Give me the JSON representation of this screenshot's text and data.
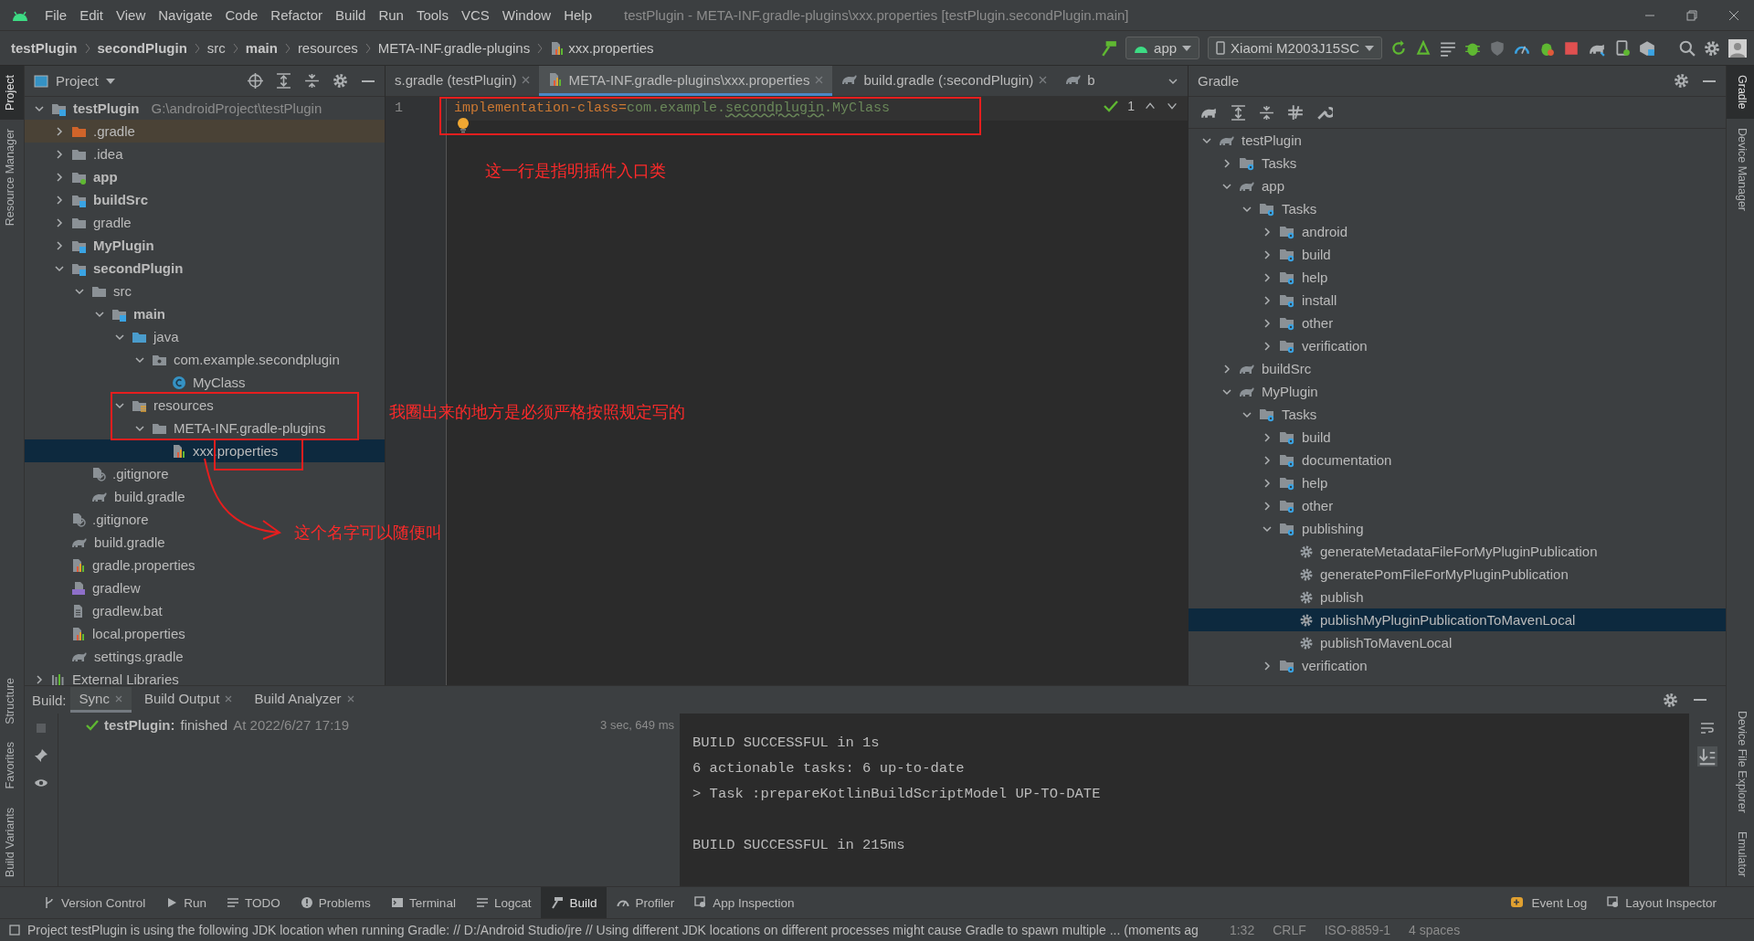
{
  "window": {
    "title": "testPlugin - META-INF.gradle-plugins\\xxx.properties [testPlugin.secondPlugin.main]"
  },
  "menu": [
    "File",
    "Edit",
    "View",
    "Navigate",
    "Code",
    "Refactor",
    "Build",
    "Run",
    "Tools",
    "VCS",
    "Window",
    "Help"
  ],
  "breadcrumbs": [
    {
      "label": "testPlugin",
      "bold": true
    },
    {
      "label": "secondPlugin",
      "bold": true
    },
    {
      "label": "src",
      "bold": false
    },
    {
      "label": "main",
      "bold": true
    },
    {
      "label": "resources",
      "bold": false
    },
    {
      "label": "META-INF.gradle-plugins",
      "bold": false
    },
    {
      "label": "xxx.properties",
      "bold": false
    }
  ],
  "toolbar": {
    "run_config": "app",
    "device": "Xiaomi M2003J15SC"
  },
  "tool_stripes": {
    "left_top": [
      {
        "label": "Project",
        "selected": true
      },
      {
        "label": "Resource Manager",
        "selected": false
      }
    ],
    "left_bottom": [
      {
        "label": "Structure",
        "selected": false
      },
      {
        "label": "Favorites",
        "selected": false
      },
      {
        "label": "Build Variants",
        "selected": false
      }
    ],
    "right_top": [
      {
        "label": "Gradle",
        "selected": true
      },
      {
        "label": "Device Manager",
        "selected": false
      }
    ],
    "right_bottom": [
      {
        "label": "Device File Explorer",
        "selected": false
      },
      {
        "label": "Emulator",
        "selected": false
      }
    ]
  },
  "project_panel": {
    "title": "Project",
    "tree": [
      {
        "label": "testPlugin",
        "detail": "G:\\androidProject\\testPlugin",
        "kind": "module",
        "bold": true,
        "expanded": true,
        "selected": false,
        "children": [
          {
            "label": ".gradle",
            "kind": "excluded-folder",
            "expanded": false,
            "selected": false
          },
          {
            "label": ".idea",
            "kind": "folder",
            "expanded": false,
            "selected": false
          },
          {
            "label": "app",
            "kind": "app-module",
            "bold": true,
            "expanded": false,
            "selected": false
          },
          {
            "label": "buildSrc",
            "kind": "module",
            "bold": true,
            "expanded": false,
            "selected": false
          },
          {
            "label": "gradle",
            "kind": "folder",
            "expanded": false,
            "selected": false
          },
          {
            "label": "MyPlugin",
            "kind": "module",
            "bold": true,
            "expanded": false,
            "selected": false
          },
          {
            "label": "secondPlugin",
            "kind": "module",
            "bold": true,
            "expanded": true,
            "selected": false,
            "children": [
              {
                "label": "src",
                "kind": "folder",
                "expanded": true,
                "selected": false,
                "children": [
                  {
                    "label": "main",
                    "kind": "module",
                    "bold": true,
                    "expanded": true,
                    "selected": false,
                    "children": [
                      {
                        "label": "java",
                        "kind": "source-folder",
                        "expanded": true,
                        "selected": false,
                        "children": [
                          {
                            "label": "com.example.secondplugin",
                            "kind": "package",
                            "expanded": true,
                            "selected": false,
                            "children": [
                              {
                                "label": "MyClass",
                                "kind": "class",
                                "selected": false
                              }
                            ]
                          }
                        ]
                      },
                      {
                        "label": "resources",
                        "kind": "resources-folder",
                        "expanded": true,
                        "selected": false,
                        "children": [
                          {
                            "label": "META-INF.gradle-plugins",
                            "kind": "folder",
                            "expanded": true,
                            "selected": false,
                            "children": [
                              {
                                "label": "xxx.properties",
                                "kind": "properties",
                                "selected": true
                              }
                            ]
                          }
                        ]
                      }
                    ]
                  }
                ]
              },
              {
                "label": ".gitignore",
                "kind": "gitignore",
                "selected": false
              },
              {
                "label": "build.gradle",
                "kind": "gradle",
                "selected": false
              }
            ]
          },
          {
            "label": ".gitignore",
            "kind": "gitignore",
            "selected": false
          },
          {
            "label": "build.gradle",
            "kind": "gradle",
            "selected": false
          },
          {
            "label": "gradle.properties",
            "kind": "properties",
            "selected": false
          },
          {
            "label": "gradlew",
            "kind": "script",
            "selected": false
          },
          {
            "label": "gradlew.bat",
            "kind": "file",
            "selected": false
          },
          {
            "label": "local.properties",
            "kind": "properties",
            "selected": false
          },
          {
            "label": "settings.gradle",
            "kind": "gradle",
            "selected": false
          }
        ]
      },
      {
        "label": "External Libraries",
        "kind": "library",
        "expanded": false,
        "selected": false
      }
    ]
  },
  "editor": {
    "tabs": [
      {
        "label": "s.gradle (testPlugin)",
        "kind": "plain",
        "selected": false,
        "closable": true
      },
      {
        "label": "META-INF.gradle-plugins\\xxx.properties",
        "kind": "properties",
        "selected": true,
        "closable": true
      },
      {
        "label": "build.gradle (:secondPlugin)",
        "kind": "gradle",
        "selected": false,
        "closable": true
      },
      {
        "label": "b",
        "kind": "gradle",
        "selected": false,
        "closable": false
      }
    ],
    "lines": [
      {
        "number": "1",
        "tokens": [
          {
            "text": "implementation-class",
            "kind": "key"
          },
          {
            "text": "=",
            "kind": "sep"
          },
          {
            "text": "com.example.",
            "kind": "value"
          },
          {
            "text": "secondplugin",
            "kind": "typo"
          },
          {
            "text": ".MyClass",
            "kind": "value"
          }
        ]
      }
    ],
    "inspection": "1"
  },
  "gradle_panel": {
    "title": "Gradle",
    "tree": [
      {
        "label": "testPlugin",
        "kind": "elephant",
        "expanded": true,
        "selected": false,
        "children": [
          {
            "label": "Tasks",
            "kind": "task-folder",
            "expanded": false,
            "selected": false
          },
          {
            "label": "app",
            "kind": "elephant",
            "expanded": true,
            "selected": false,
            "children": [
              {
                "label": "Tasks",
                "kind": "task-folder",
                "expanded": true,
                "selected": false,
                "children": [
                  {
                    "label": "android",
                    "kind": "task-folder",
                    "expanded": false,
                    "selected": false
                  },
                  {
                    "label": "build",
                    "kind": "task-folder",
                    "expanded": false,
                    "selected": false
                  },
                  {
                    "label": "help",
                    "kind": "task-folder",
                    "expanded": false,
                    "selected": false
                  },
                  {
                    "label": "install",
                    "kind": "task-folder",
                    "expanded": false,
                    "selected": false
                  },
                  {
                    "label": "other",
                    "kind": "task-folder",
                    "expanded": false,
                    "selected": false
                  },
                  {
                    "label": "verification",
                    "kind": "task-folder",
                    "expanded": false,
                    "selected": false
                  }
                ]
              }
            ]
          },
          {
            "label": "buildSrc",
            "kind": "elephant",
            "expanded": false,
            "selected": false
          },
          {
            "label": "MyPlugin",
            "kind": "elephant",
            "expanded": true,
            "selected": false,
            "children": [
              {
                "label": "Tasks",
                "kind": "task-folder",
                "expanded": true,
                "selected": false,
                "children": [
                  {
                    "label": "build",
                    "kind": "task-folder",
                    "expanded": false,
                    "selected": false
                  },
                  {
                    "label": "documentation",
                    "kind": "task-folder",
                    "expanded": false,
                    "selected": false
                  },
                  {
                    "label": "help",
                    "kind": "task-folder",
                    "expanded": false,
                    "selected": false
                  },
                  {
                    "label": "other",
                    "kind": "task-folder",
                    "expanded": false,
                    "selected": false
                  },
                  {
                    "label": "publishing",
                    "kind": "task-folder",
                    "expanded": true,
                    "selected": false,
                    "children": [
                      {
                        "label": "generateMetadataFileForMyPluginPublication",
                        "kind": "gear",
                        "selected": false
                      },
                      {
                        "label": "generatePomFileForMyPluginPublication",
                        "kind": "gear",
                        "selected": false
                      },
                      {
                        "label": "publish",
                        "kind": "gear",
                        "selected": false
                      },
                      {
                        "label": "publishMyPluginPublicationToMavenLocal",
                        "kind": "gear",
                        "selected": true
                      },
                      {
                        "label": "publishToMavenLocal",
                        "kind": "gear",
                        "selected": false
                      }
                    ]
                  },
                  {
                    "label": "verification",
                    "kind": "task-folder",
                    "expanded": false,
                    "selected": false
                  }
                ]
              }
            ]
          }
        ]
      }
    ]
  },
  "build_panel": {
    "label": "Build:",
    "tabs": [
      {
        "label": "Sync",
        "selected": true
      },
      {
        "label": "Build Output",
        "selected": false
      },
      {
        "label": "Build Analyzer",
        "selected": false
      }
    ],
    "result": {
      "project": "testPlugin:",
      "status": "finished",
      "time": "At 2022/6/27 17:19",
      "duration": "3 sec, 649 ms"
    },
    "console": [
      [
        "BUILD SUCCESSFUL in 1s",
        "6 actionable tasks: 6 up-to-date",
        "> Task :prepareKotlinBuildScriptModel UP-TO-DATE"
      ],
      [
        "BUILD SUCCESSFUL in 215ms"
      ]
    ]
  },
  "bottom_tools": {
    "left": [
      {
        "label": "Version Control",
        "kind": "branch",
        "selected": false
      },
      {
        "label": "Run",
        "kind": "play",
        "selected": false
      },
      {
        "label": "TODO",
        "kind": "list",
        "selected": false
      },
      {
        "label": "Problems",
        "kind": "info",
        "selected": false
      },
      {
        "label": "Terminal",
        "kind": "terminal",
        "selected": false
      },
      {
        "label": "Logcat",
        "kind": "list",
        "selected": false
      },
      {
        "label": "Build",
        "kind": "hammer",
        "selected": true
      },
      {
        "label": "Profiler",
        "kind": "gauge",
        "selected": false
      },
      {
        "label": "App Inspection",
        "kind": "inspect",
        "selected": false
      }
    ],
    "right": [
      {
        "label": "Event Log",
        "kind": "event",
        "selected": false
      },
      {
        "label": "Layout Inspector",
        "kind": "inspect",
        "selected": false
      }
    ]
  },
  "status_bar": {
    "message": "Project testPlugin is using the following JDK location when running Gradle: // D:/Android Studio/jre // Using different JDK locations on different processes might cause Gradle to spawn multiple ... (moments ag",
    "items": [
      "1:32",
      "CRLF",
      "ISO-8859-1",
      "4 spaces"
    ]
  },
  "annotations": [
    "这一行是指明插件入口类",
    "我圈出来的地方是必须严格按照规定写的",
    "这个名字可以随便叫"
  ]
}
